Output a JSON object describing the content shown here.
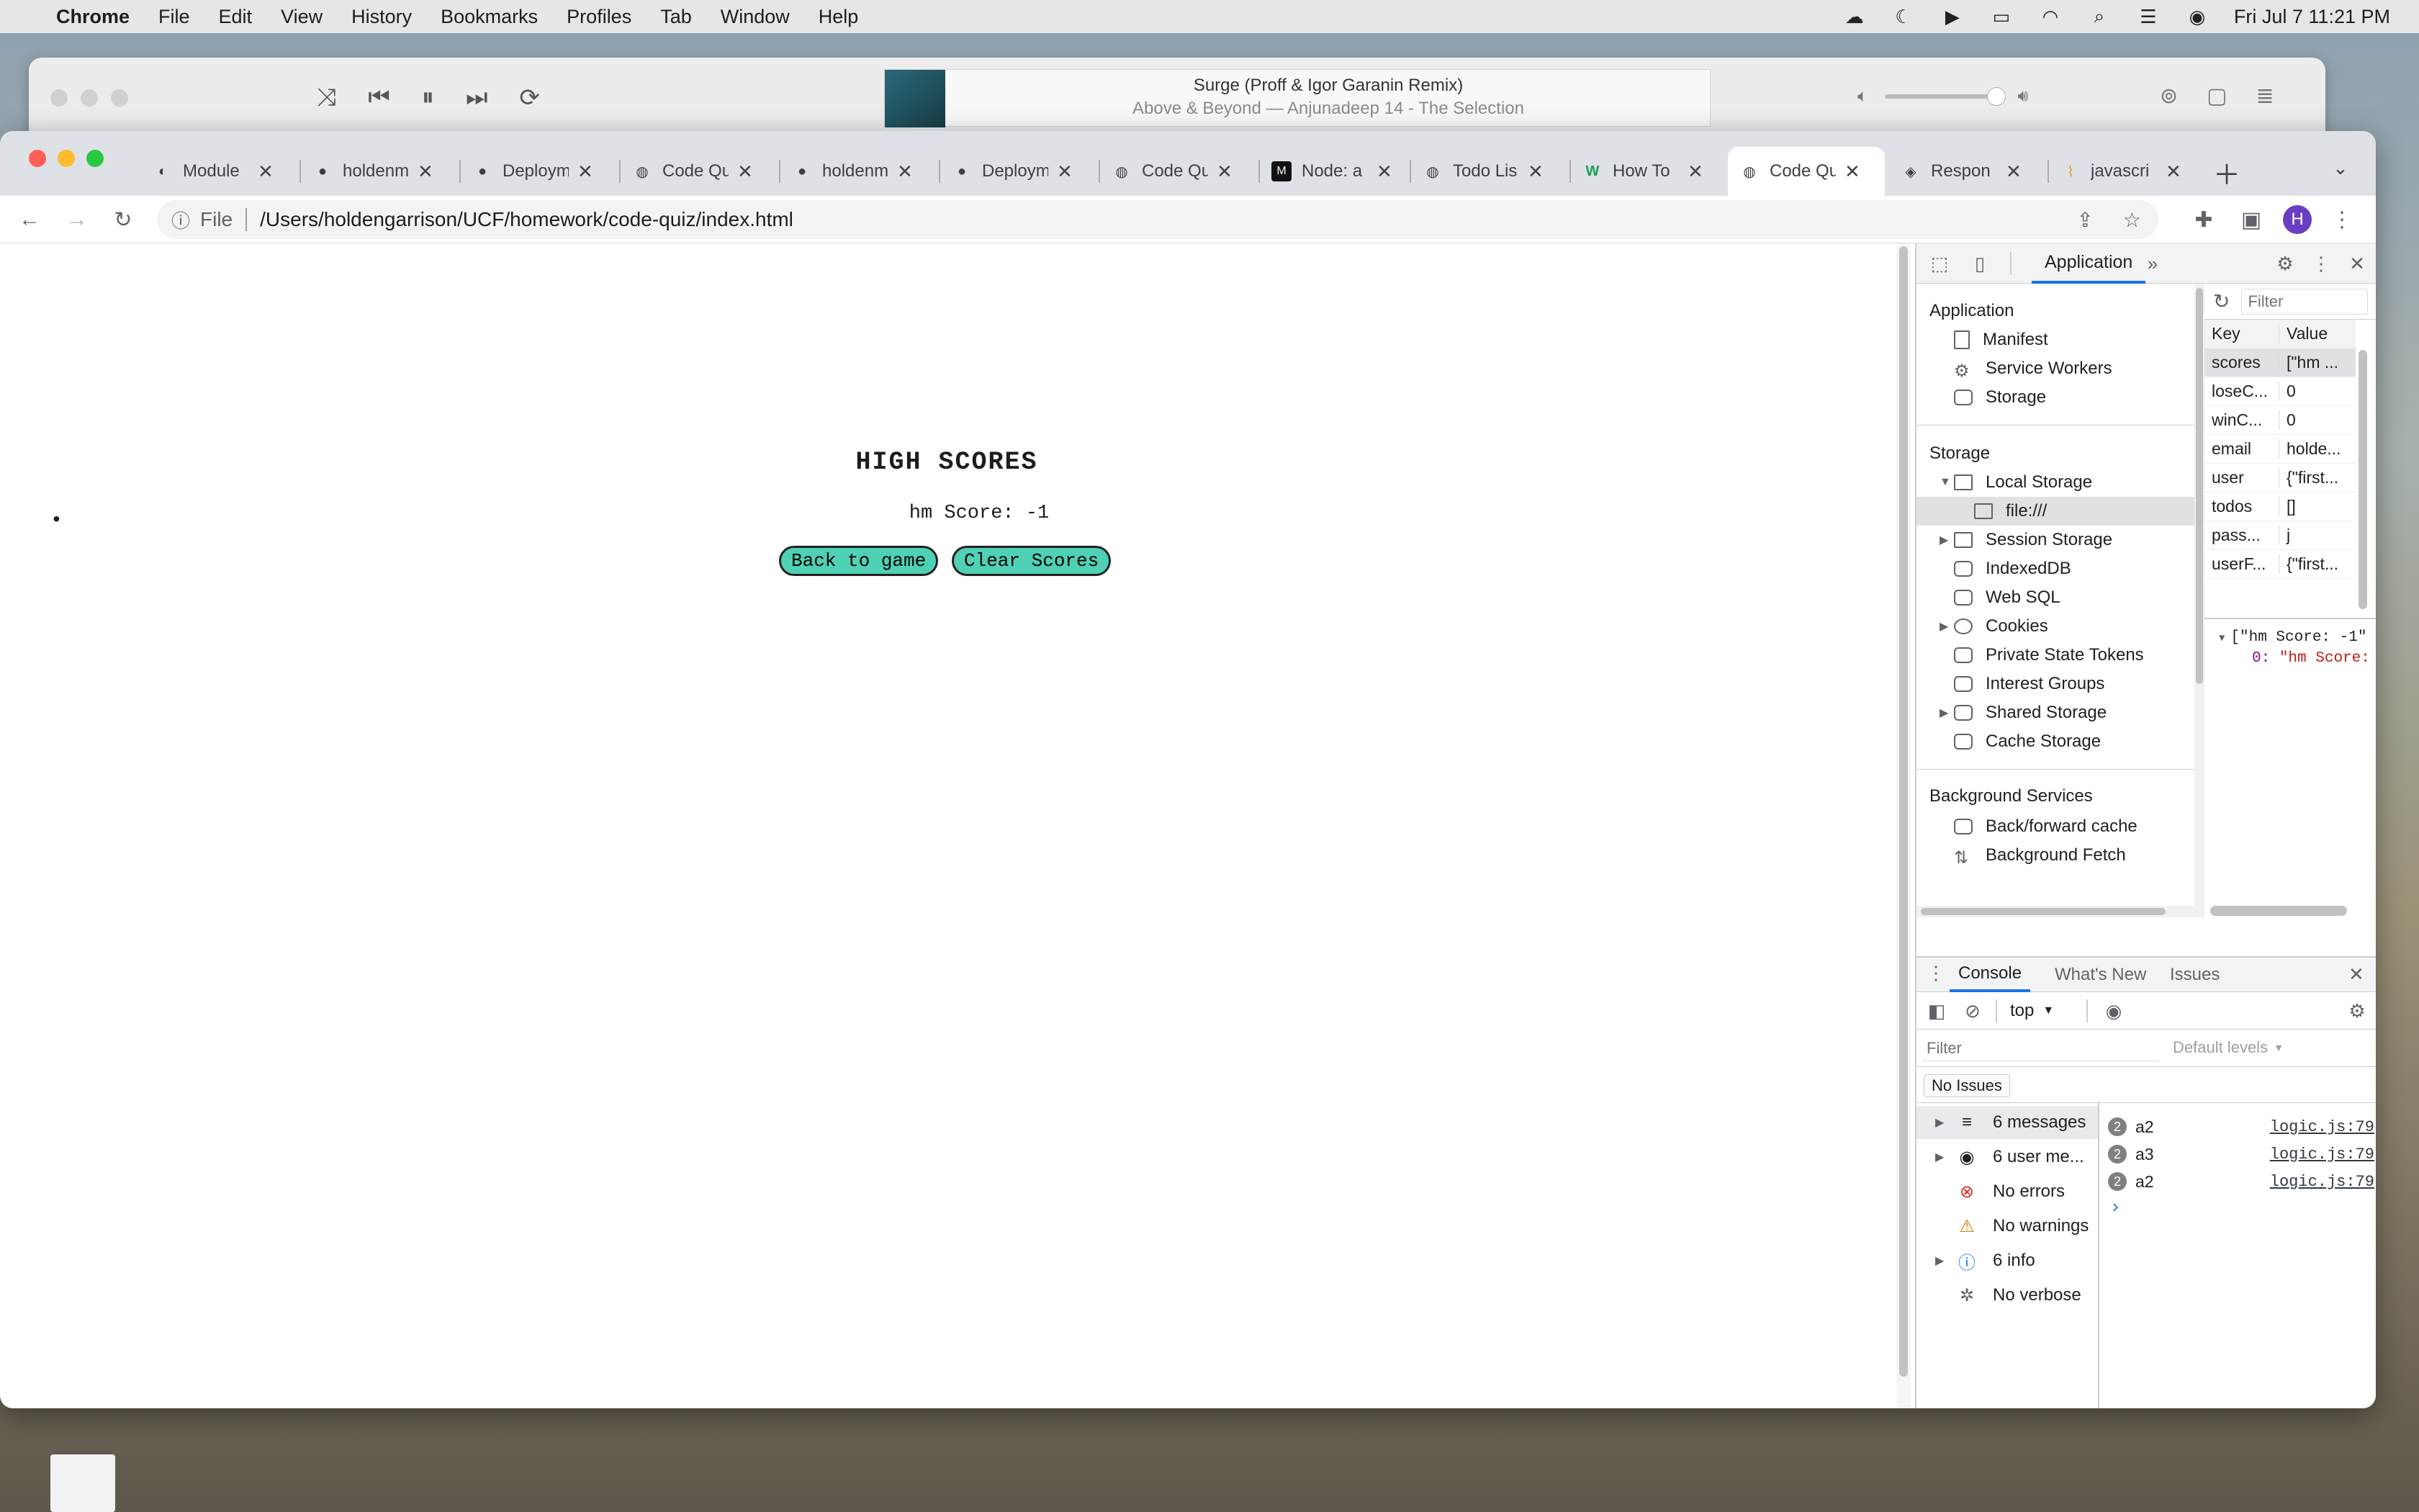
{
  "menubar": {
    "app": "Chrome",
    "items": [
      "File",
      "Edit",
      "View",
      "History",
      "Bookmarks",
      "Profiles",
      "Tab",
      "Window",
      "Help"
    ],
    "clock": "Fri Jul 7  11:21 PM"
  },
  "player": {
    "track": "Surge (Proff & Igor Garanin Remix)",
    "artist": "Above & Beyond — Anjunadeep 14 - The Selection"
  },
  "tabs": [
    {
      "title": "Module",
      "fav": "◐"
    },
    {
      "title": "holdenm",
      "fav": "●"
    },
    {
      "title": "Deploym",
      "fav": "●"
    },
    {
      "title": "Code Qu",
      "fav": "◍"
    },
    {
      "title": "holdenm",
      "fav": "●"
    },
    {
      "title": "Deploym",
      "fav": "●"
    },
    {
      "title": "Code Qu",
      "fav": "◍"
    },
    {
      "title": "Node: a",
      "fav": "M"
    },
    {
      "title": "Todo Lis",
      "fav": "◍"
    },
    {
      "title": "How To",
      "fav": "W"
    },
    {
      "title": "Code Qu",
      "fav": "◍"
    },
    {
      "title": "Respon",
      "fav": "◈"
    },
    {
      "title": "javascri",
      "fav": "⌇"
    }
  ],
  "address": {
    "scheme": "File",
    "url": "/Users/holdengarrison/UCF/homework/code-quiz/index.html"
  },
  "profile_initial": "H",
  "page": {
    "title": "HIGH SCORES",
    "score": "hm Score: -1",
    "back_label": "Back to game",
    "clear_label": "Clear Scores"
  },
  "devtools": {
    "panel": "Application",
    "filter_placeholder": "Filter",
    "sections": {
      "application": "Application",
      "storage": "Storage",
      "background": "Background Services"
    },
    "app_items": [
      "Manifest",
      "Service Workers",
      "Storage"
    ],
    "storage_items": [
      "Local Storage",
      "file:///",
      "Session Storage",
      "IndexedDB",
      "Web SQL",
      "Cookies",
      "Private State Tokens",
      "Interest Groups",
      "Shared Storage",
      "Cache Storage"
    ],
    "bg_items": [
      "Back/forward cache",
      "Background Fetch"
    ],
    "table_headers": {
      "key": "Key",
      "value": "Value"
    },
    "rows": [
      {
        "k": "scores",
        "v": "[\"hm ..."
      },
      {
        "k": "loseC...",
        "v": "0"
      },
      {
        "k": "winC...",
        "v": "0"
      },
      {
        "k": "email",
        "v": "holde..."
      },
      {
        "k": "user",
        "v": "{\"first..."
      },
      {
        "k": "todos",
        "v": "[]"
      },
      {
        "k": "pass...",
        "v": "j"
      },
      {
        "k": "userF...",
        "v": "{\"first..."
      }
    ],
    "preview_line1": "[\"hm Score: -1\"",
    "preview_line2_key": "0:",
    "preview_line2_val": "\"hm Score:"
  },
  "console": {
    "tabs": [
      "Console",
      "What's New",
      "Issues"
    ],
    "context": "top",
    "filter_placeholder": "Filter",
    "levels": "Default levels",
    "issues": "No Issues",
    "sidebar": [
      {
        "label": "6 messages",
        "icon": "≡"
      },
      {
        "label": "6 user me...",
        "icon": "◉"
      },
      {
        "label": "No errors",
        "icon": "⊗"
      },
      {
        "label": "No warnings",
        "icon": "⚠"
      },
      {
        "label": "6 info",
        "icon": "ⓘ"
      },
      {
        "label": "No verbose",
        "icon": "✲"
      }
    ],
    "messages": [
      {
        "count": "2",
        "text": "a2",
        "src": "logic.js:79"
      },
      {
        "count": "2",
        "text": "a3",
        "src": "logic.js:79"
      },
      {
        "count": "2",
        "text": "a2",
        "src": "logic.js:79"
      }
    ],
    "prompt": "›"
  },
  "colors": {
    "accent": "#4fd1b5",
    "devtools_blue": "#1a73e8"
  }
}
